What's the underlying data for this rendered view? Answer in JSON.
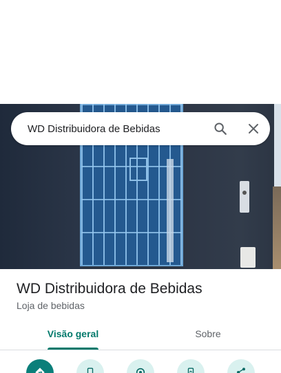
{
  "search": {
    "query": "WD Distribuidora de Bebidas"
  },
  "place": {
    "name": "WD Distribuidora de Bebidas",
    "category": "Loja de bebidas"
  },
  "tabs": [
    {
      "label": "Visão geral",
      "active": true
    },
    {
      "label": "Sobre",
      "active": false
    }
  ],
  "actions": [
    {
      "icon": "directions-icon"
    },
    {
      "icon": "phone-icon"
    },
    {
      "icon": "save-icon"
    },
    {
      "icon": "send-to-phone-icon"
    },
    {
      "icon": "share-icon"
    }
  ],
  "colors": {
    "accent": "#00796b",
    "primary_action": "#0b7f7a",
    "secondary_action": "#d9f1ef"
  }
}
